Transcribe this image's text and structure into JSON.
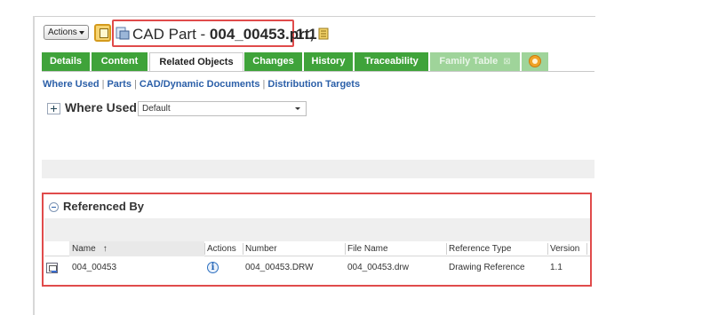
{
  "header": {
    "actions_label": "Actions",
    "title_prefix": "CAD Part - ",
    "title_name": "004_00453.prt,",
    "version": "1.1"
  },
  "tabs": [
    {
      "label": "Details",
      "state": "normal"
    },
    {
      "label": "Content",
      "state": "normal"
    },
    {
      "label": "Related Objects",
      "state": "active"
    },
    {
      "label": "Changes",
      "state": "normal"
    },
    {
      "label": "History",
      "state": "normal"
    },
    {
      "label": "Traceability",
      "state": "normal"
    },
    {
      "label": "Family Table",
      "state": "disabled"
    }
  ],
  "subnav": {
    "links": [
      "Where Used",
      "Parts",
      "CAD/Dynamic Documents",
      "Distribution Targets"
    ],
    "separator": "|"
  },
  "where_used": {
    "title": "Where Used",
    "filter_value": "Default"
  },
  "referenced_by": {
    "title": "Referenced By",
    "columns": [
      "Name",
      "Actions",
      "Number",
      "File Name",
      "Reference Type",
      "Version"
    ],
    "sort_indicator": "↑",
    "rows": [
      {
        "name": "004_00453",
        "number": "004_00453.DRW",
        "file_name": "004_00453.drw",
        "reference_type": "Drawing Reference",
        "version": "1.1"
      }
    ]
  },
  "colors": {
    "tab_green": "#3fa33a",
    "tab_disabled": "#9fd49a",
    "link_blue": "#2b5fa8",
    "highlight_red": "#e04b4b"
  },
  "icons": [
    "caret-down-icon",
    "note-icon",
    "cad-part-icon",
    "stack-icon",
    "related-add-icon",
    "expand-icon",
    "collapse-icon",
    "drawing-icon",
    "info-icon"
  ]
}
